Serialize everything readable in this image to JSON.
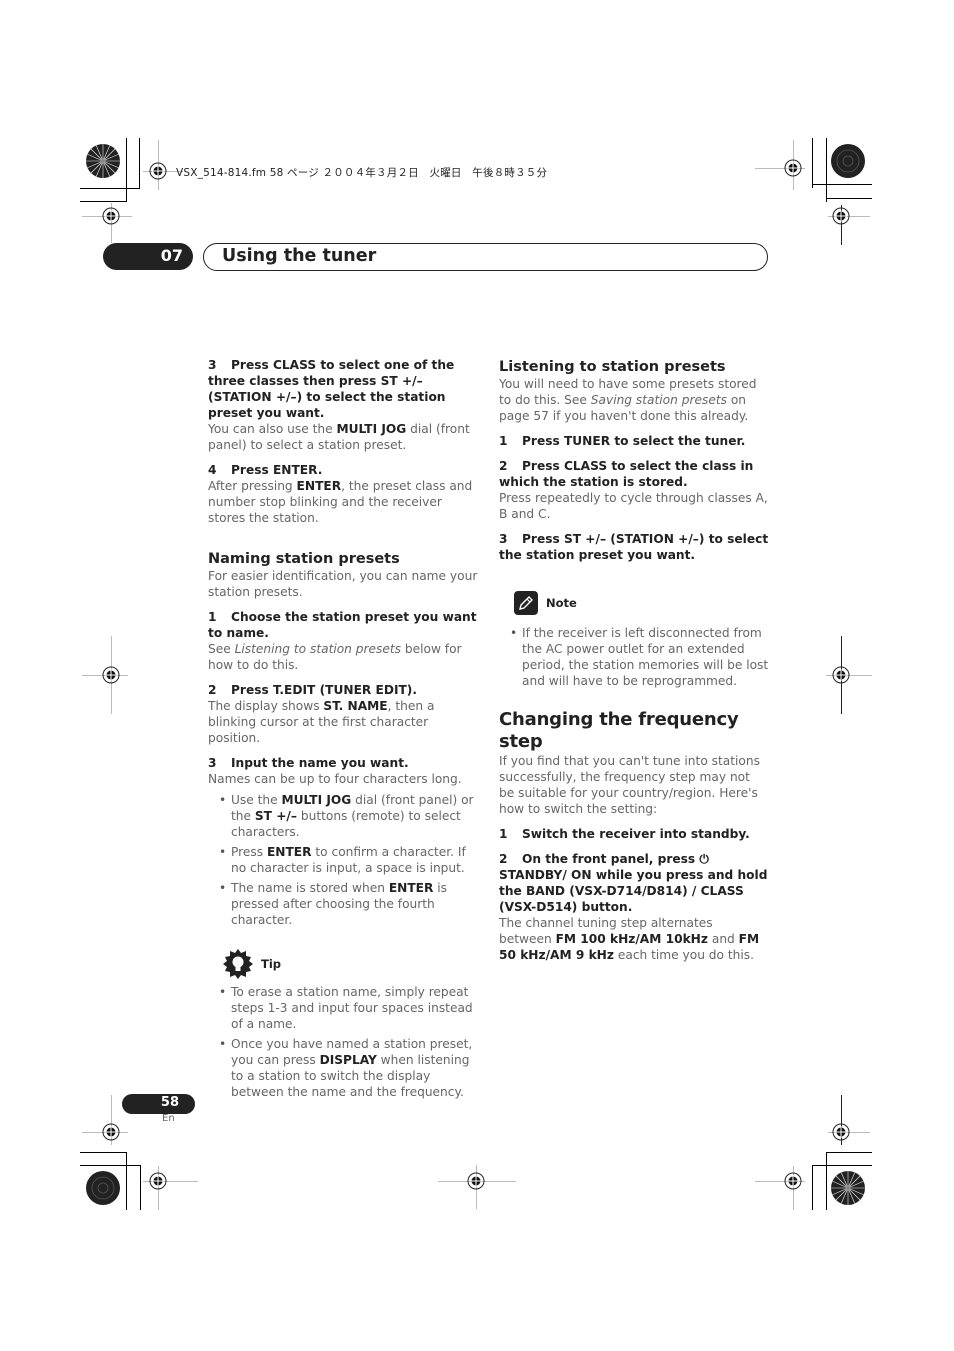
{
  "file_header": "VSX_514-814.fm  58 ページ  ２００４年３月２日　火曜日　午後８時３５分",
  "chapter": {
    "number": "07",
    "title": "Using the tuner"
  },
  "left_column": {
    "step3": {
      "num": "3",
      "text": "Press CLASS to select one of the three classes then press ST +/– (STATION +/–) to select the station preset you want."
    },
    "step3_body": {
      "pre": "You can also use the ",
      "bold": "MULTI JOG",
      "post": " dial (front panel) to select a station preset."
    },
    "step4": {
      "num": "4",
      "text": "Press ENTER."
    },
    "step4_body": {
      "pre": "After pressing ",
      "bold": "ENTER",
      "post": ", the preset class and number stop blinking and the receiver stores the station."
    },
    "naming": {
      "heading": "Naming station presets",
      "intro": "For easier identification, you can name your station presets.",
      "step1": {
        "num": "1",
        "text": "Choose the station preset you want to name."
      },
      "step1_body": {
        "pre": "See ",
        "italic": "Listening to station presets",
        "post": " below for how to do this."
      },
      "step2": {
        "num": "2",
        "text": "Press T.EDIT (TUNER EDIT)."
      },
      "step2_body": {
        "pre": "The display shows ",
        "bold": "ST. NAME",
        "post": ", then a blinking cursor at the first character position."
      },
      "step3": {
        "num": "3",
        "text": "Input the name you want."
      },
      "step3_body": "Names can be up to four characters long.",
      "bullets": [
        {
          "pre": "Use the ",
          "bold1": "MULTI JOG",
          "mid": " dial (front panel) or the ",
          "bold2": "ST +/–",
          "post": " buttons (remote) to select characters."
        },
        {
          "pre": "Press ",
          "bold1": "ENTER",
          "post": " to confirm a character. If no character is input, a space is input."
        },
        {
          "pre": "The name is stored when ",
          "bold1": "ENTER",
          "post": " is pressed after choosing the fourth character."
        }
      ]
    },
    "tip": {
      "label": "Tip",
      "bullets": [
        {
          "text": "To erase a station name, simply repeat steps 1-3 and input four spaces instead of a name."
        },
        {
          "pre": "Once you have named a station preset, you can press ",
          "bold": "DISPLAY",
          "post": " when listening to a station to switch the display between the name and the frequency."
        }
      ]
    }
  },
  "right_column": {
    "listening": {
      "heading": "Listening to station presets",
      "intro": {
        "pre": "You will need to have some presets stored to do this. See ",
        "italic": "Saving station presets",
        "post": " on page 57 if you haven't done this already."
      },
      "step1": {
        "num": "1",
        "text": "Press TUNER to select the tuner."
      },
      "step2": {
        "num": "2",
        "text": "Press CLASS to select the class in which the station is stored."
      },
      "step2_body": "Press repeatedly to cycle through classes A, B and C.",
      "step3": {
        "num": "3",
        "text": "Press ST +/– (STATION +/–) to select the station preset you want."
      }
    },
    "note": {
      "label": "Note",
      "bullets": [
        "If the receiver is left disconnected from the AC power outlet for an extended period, the station memories will be lost and will have to be reprogrammed."
      ]
    },
    "freq": {
      "heading": "Changing the frequency step",
      "intro": "If you find that you can't tune into stations successfully, the frequency step may not be suitable for your country/region. Here's how to switch the setting:",
      "step1": {
        "num": "1",
        "text": "Switch the receiver into standby."
      },
      "step2": {
        "num": "2",
        "pre": "On the front panel, press ",
        "icon": "⏻",
        "post": " STANDBY/ ON while you press and hold the BAND (VSX-D714/D814) / CLASS (VSX-D514) button."
      },
      "step2_body": {
        "pre": "The channel tuning step alternates between ",
        "bold1": "FM 100 kHz/AM 10kHz",
        "mid": " and ",
        "bold2": "FM 50 kHz/AM 9 kHz",
        "post": " each time you do this."
      }
    }
  },
  "footer": {
    "page_number": "58",
    "language": "En"
  }
}
